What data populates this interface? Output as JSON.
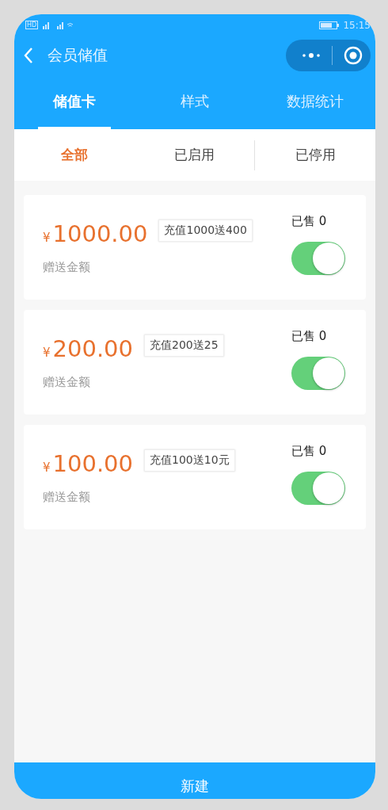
{
  "status_bar": {
    "network": "HD",
    "time": "15:15"
  },
  "header": {
    "title": "会员储值"
  },
  "tabs": [
    {
      "label": "储值卡",
      "selected": true
    },
    {
      "label": "样式",
      "selected": false
    },
    {
      "label": "数据统计",
      "selected": false
    }
  ],
  "filters": [
    {
      "label": "全部",
      "selected": true
    },
    {
      "label": "已启用",
      "selected": false
    },
    {
      "label": "已停用",
      "selected": false
    }
  ],
  "cards": [
    {
      "currency": "¥",
      "amount": "1000.00",
      "tag": "充值1000送400",
      "caption": "赠送金额",
      "sold": "已售 0",
      "on": true
    },
    {
      "currency": "¥",
      "amount": "200.00",
      "tag": "充值200送25",
      "caption": "赠送金额",
      "sold": "已售 0",
      "on": true
    },
    {
      "currency": "¥",
      "amount": "100.00",
      "tag": "充值100送10元",
      "caption": "赠送金额",
      "sold": "已售 0",
      "on": true
    }
  ],
  "new_button": {
    "label": "新建"
  }
}
